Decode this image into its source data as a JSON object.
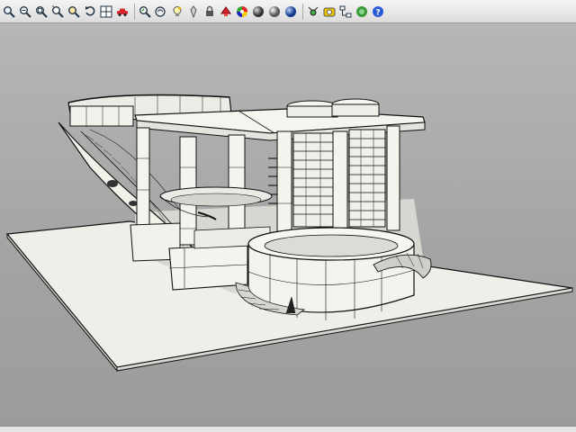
{
  "toolbar": {
    "icons": [
      "zoom-icon",
      "pan-icon",
      "zoom-window-icon",
      "zoom-extents-icon",
      "zoom-selected-icon",
      "rotate-view-icon",
      "viewport-layout-icon",
      "car-icon",
      "undo-view-icon",
      "zoom-dynamic-icon",
      "bulb-icon",
      "pin-icon",
      "lock-icon",
      "paint-icon",
      "color-wheel-icon",
      "shaded-sphere-icon",
      "rendered-sphere-icon",
      "render-icon",
      "grasshopper-icon",
      "snapshot-icon",
      "network-icon",
      "help-icon"
    ]
  },
  "colors": {
    "viewport_bg": "#a8a8a8",
    "model_face": "#f2f2ec",
    "model_edge": "#1a1a1a",
    "ground": "#f0f0ec"
  }
}
